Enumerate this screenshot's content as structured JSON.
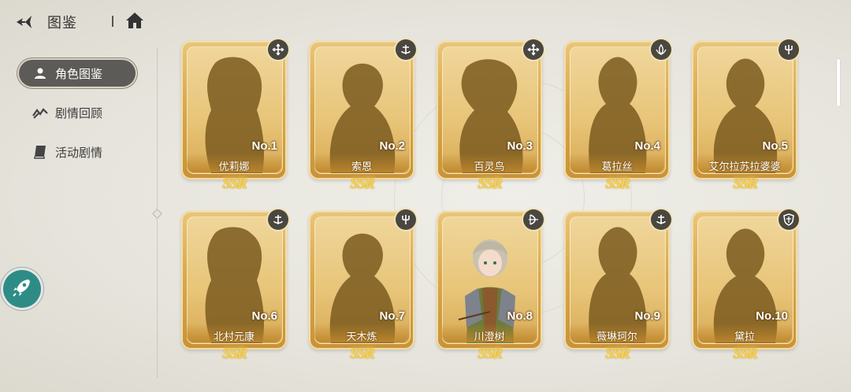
{
  "header": {
    "title": "图鉴",
    "back_icon": "back-arrow-icon",
    "home_icon": "home-icon"
  },
  "sidebar": {
    "items": [
      {
        "label": "角色图鉴",
        "icon": "person-icon",
        "active": true
      },
      {
        "label": "剧情回顾",
        "icon": "story-review-icon",
        "active": false
      },
      {
        "label": "活动剧情",
        "icon": "book-icon",
        "active": false
      }
    ]
  },
  "floating": {
    "icon": "rocket-icon",
    "color": "#2e8c86"
  },
  "cards": [
    {
      "no": "No.1",
      "name": "优莉娜",
      "rarity": "SSR",
      "role_icon": "cross-arrows-icon",
      "revealed": false
    },
    {
      "no": "No.2",
      "name": "索恩",
      "rarity": "SSR",
      "role_icon": "anchor-icon",
      "revealed": false
    },
    {
      "no": "No.3",
      "name": "百灵鸟",
      "rarity": "SSR",
      "role_icon": "cross-arrows-icon",
      "revealed": false
    },
    {
      "no": "No.4",
      "name": "葛拉丝",
      "rarity": "SSR",
      "role_icon": "lotus-icon",
      "revealed": false
    },
    {
      "no": "No.5",
      "name": "艾尔拉苏拉婆婆",
      "rarity": "SSR",
      "role_icon": "trident-icon",
      "revealed": false
    },
    {
      "no": "No.6",
      "name": "北村元康",
      "rarity": "SSR",
      "role_icon": "anchor-icon",
      "revealed": false
    },
    {
      "no": "No.7",
      "name": "天木炼",
      "rarity": "SSR",
      "role_icon": "trident-icon",
      "revealed": false
    },
    {
      "no": "No.8",
      "name": "川澄树",
      "rarity": "SSR",
      "role_icon": "bow-icon",
      "revealed": true
    },
    {
      "no": "No.9",
      "name": "薇琳珂尔",
      "rarity": "SSR",
      "role_icon": "anchor-icon",
      "revealed": false
    },
    {
      "no": "No.10",
      "name": "黛拉",
      "rarity": "SSR",
      "role_icon": "shield-icon",
      "revealed": false
    }
  ],
  "colors": {
    "card_gold": "#d9a94f",
    "silhouette": "#7a5a1e",
    "active_menu_bg": "#5d5b57",
    "rarity_gold": "#f5cf54"
  }
}
